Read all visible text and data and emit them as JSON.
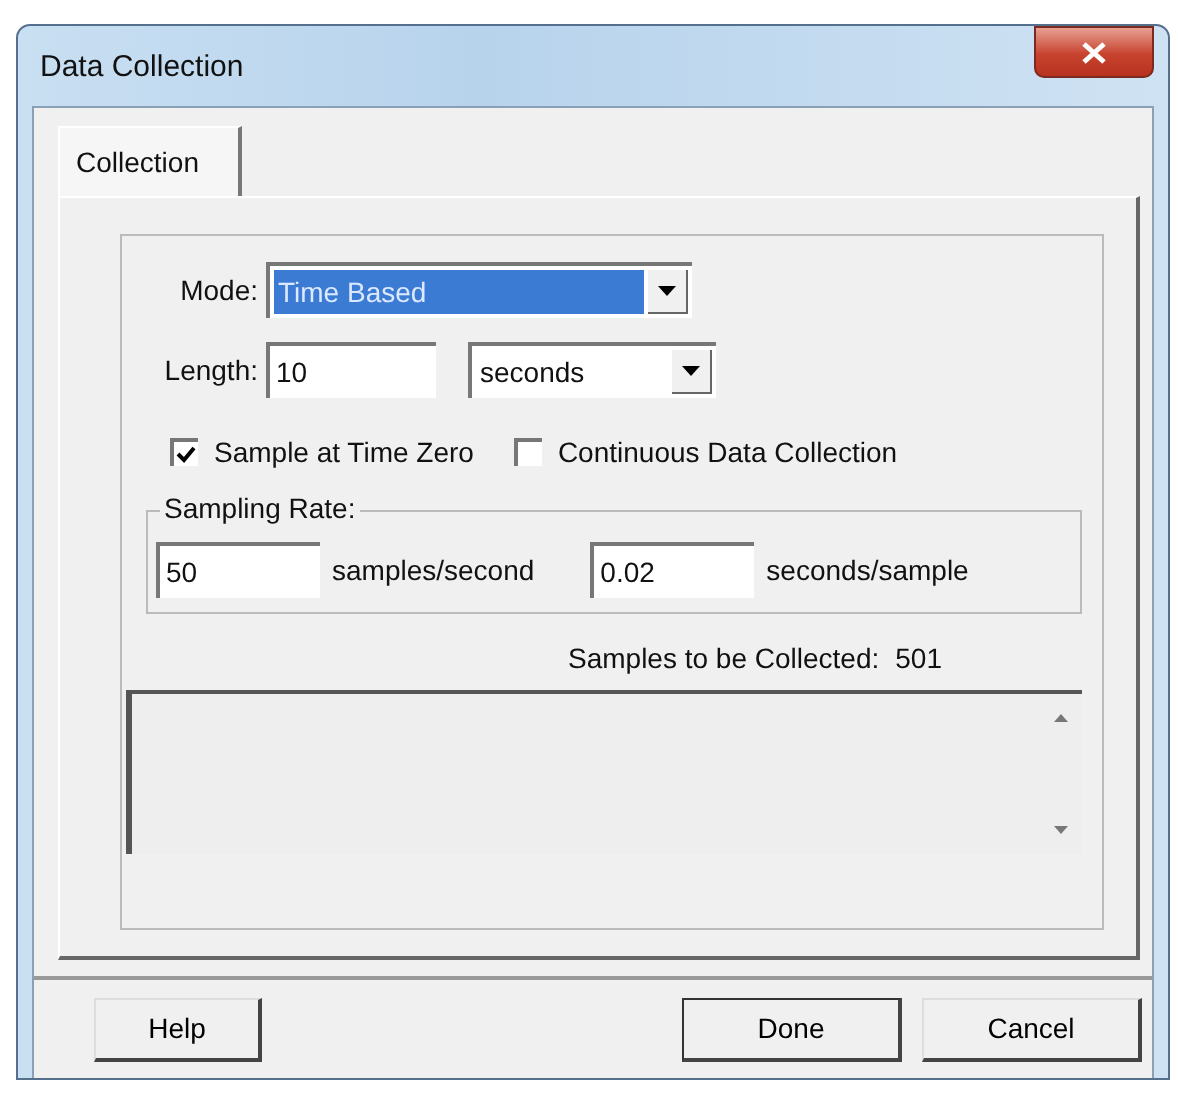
{
  "window": {
    "title": "Data Collection"
  },
  "tabs": [
    {
      "label": "Collection",
      "selected": true
    }
  ],
  "mode": {
    "label": "Mode:",
    "value": "Time Based",
    "text_selected": true
  },
  "length": {
    "label": "Length:",
    "value": "10",
    "unit": "seconds"
  },
  "options": [
    {
      "label": "Sample at Time Zero",
      "checked": true
    },
    {
      "label": "Continuous Data Collection",
      "checked": false
    }
  ],
  "sampling_rate": {
    "title": "Sampling Rate:",
    "fields": [
      {
        "value": "50",
        "unit": "samples/second"
      },
      {
        "value": "0.02",
        "unit": "seconds/sample"
      }
    ]
  },
  "samples": {
    "label": "Samples to be Collected:",
    "count": "501"
  },
  "buttons": [
    {
      "label": "Help",
      "default": false
    },
    {
      "label": "Done",
      "default": true
    },
    {
      "label": "Cancel",
      "default": false
    }
  ]
}
